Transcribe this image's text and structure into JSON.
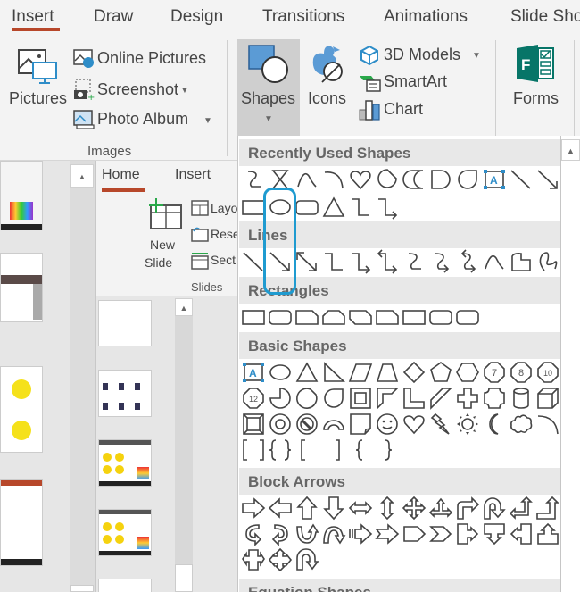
{
  "ribbon": {
    "tabs": [
      "Insert",
      "Draw",
      "Design",
      "Transitions",
      "Animations",
      "Slide Show"
    ],
    "active_tab": "Insert",
    "images_group": {
      "pictures": "Pictures",
      "online_pictures": "Online Pictures",
      "screenshot": "Screenshot",
      "photo_album": "Photo Album",
      "label": "Images"
    },
    "illustrations": {
      "shapes": "Shapes",
      "icons": "Icons",
      "models_3d": "3D Models",
      "smartart": "SmartArt",
      "chart": "Chart"
    },
    "forms": "Forms"
  },
  "inner_ribbon": {
    "tabs": [
      "Home",
      "Insert"
    ],
    "active_tab": "Home",
    "new_slide_line1": "New",
    "new_slide_line2": "Slide",
    "layout": "Layo",
    "reset": "Rese",
    "section": "Sect",
    "group_label": "Slides"
  },
  "shapes_menu": {
    "sections": [
      {
        "title": "Recently Used Shapes"
      },
      {
        "title": "Lines"
      },
      {
        "title": "Rectangles"
      },
      {
        "title": "Basic Shapes"
      },
      {
        "title": "Block Arrows"
      },
      {
        "title": "Equation Shapes"
      }
    ],
    "highlight_color": "#1f9bd0",
    "basic_shape_labels": [
      "7",
      "8",
      "10",
      "12"
    ]
  },
  "colors": {
    "accent": "#b7472a",
    "shape_fill": "#5b9bd5",
    "forms_green": "#077568"
  }
}
